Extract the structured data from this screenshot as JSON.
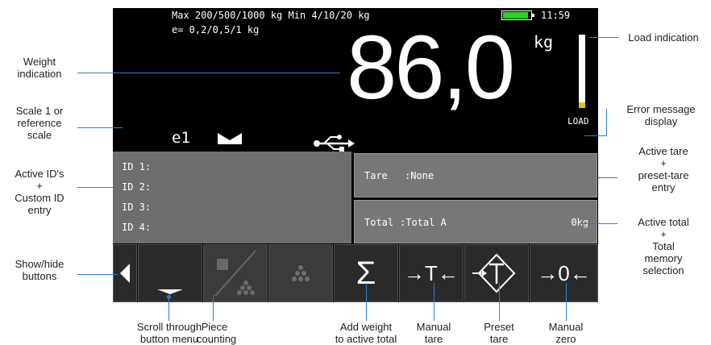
{
  "header": {
    "capacity": "Max 200/500/1000 kg Min 4/10/20 kg",
    "division": "e= 0,2/0,5/1 kg",
    "time": "11:59",
    "battery_level": 0.9
  },
  "display": {
    "weight": "86,0",
    "unit": "kg",
    "load_text": "LOAD",
    "load_level": 0.08,
    "scale": "e1"
  },
  "ids": [
    "ID 1:",
    "ID 2:",
    "ID 3:",
    "ID 4:"
  ],
  "tare": {
    "label": "Tare",
    "value": ":None"
  },
  "total": {
    "label": "Total",
    "value": ":Total A",
    "amount": "0kg"
  },
  "buttons": [
    {
      "name": "scroll-button",
      "symbol": ""
    },
    {
      "name": "piece-counting-button",
      "symbol": ""
    },
    {
      "name": "dots-button",
      "symbol": ""
    },
    {
      "name": "add-total-button",
      "symbol": "Σ"
    },
    {
      "name": "manual-tare-button",
      "symbol": "→T←"
    },
    {
      "name": "preset-tare-button",
      "symbol": ""
    },
    {
      "name": "manual-zero-button",
      "symbol": "→0←"
    }
  ],
  "annotations": {
    "weight_indication": "Weight\nindication",
    "scale1": "Scale 1 or\nreference\nscale",
    "active_ids": "Active ID's\n+\nCustom ID\nentry",
    "show_hide": "Show/hide\nbuttons",
    "load_indication": "Load indication",
    "error_message": "Error message\ndisplay",
    "active_tare": "Active tare\n+\npreset-tare\nentry",
    "active_total": "Active total\n+\nTotal\nmemory\nselection",
    "scroll": "Scroll through\nbutton menu",
    "piece": "Piece\ncounting",
    "add_weight": "Add weight\nto active total",
    "manual_tare": "Manual\ntare",
    "preset_tare": "Preset\ntare",
    "manual_zero": "Manual\nzero"
  }
}
